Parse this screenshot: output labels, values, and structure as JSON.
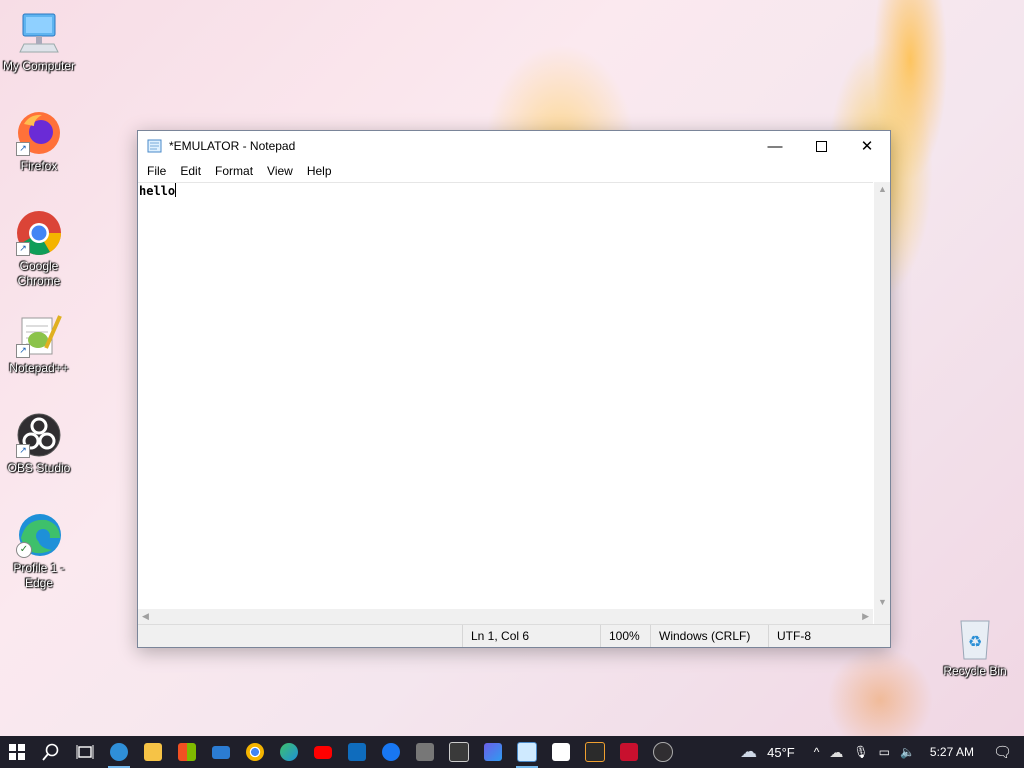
{
  "desktop": {
    "icons": [
      {
        "label": "My Computer"
      },
      {
        "label": "Firefox"
      },
      {
        "label": "Google Chrome"
      },
      {
        "label": "Notepad++"
      },
      {
        "label": "OBS Studio"
      },
      {
        "label": "Profile 1 - Edge"
      },
      {
        "label": "Recycle Bin"
      }
    ]
  },
  "window": {
    "title": "*EMULATOR - Notepad",
    "menu": [
      "File",
      "Edit",
      "Format",
      "View",
      "Help"
    ],
    "content": "hello",
    "status": {
      "position": "Ln 1, Col 6",
      "zoom": "100%",
      "line_endings": "Windows (CRLF)",
      "encoding": "UTF-8"
    }
  },
  "taskbar": {
    "apps": [
      "windows-start-icon",
      "search-icon",
      "task-view-icon",
      "edge-icon",
      "file-explorer-icon",
      "store-icon",
      "mail-icon",
      "chrome-icon",
      "edge-profile-icon",
      "youtube-icon",
      "outlook-icon",
      "facebook-icon",
      "amazon-icon",
      "calculator-icon",
      "photos-icon",
      "notepad-icon",
      "wikipedia-icon",
      "terminal-icon",
      "app-icon",
      "obs-icon"
    ],
    "weather": "45°F",
    "time": "5:27 AM"
  },
  "colors": {
    "taskbar": "#1f1f2a",
    "accent": "#76b9ed"
  }
}
